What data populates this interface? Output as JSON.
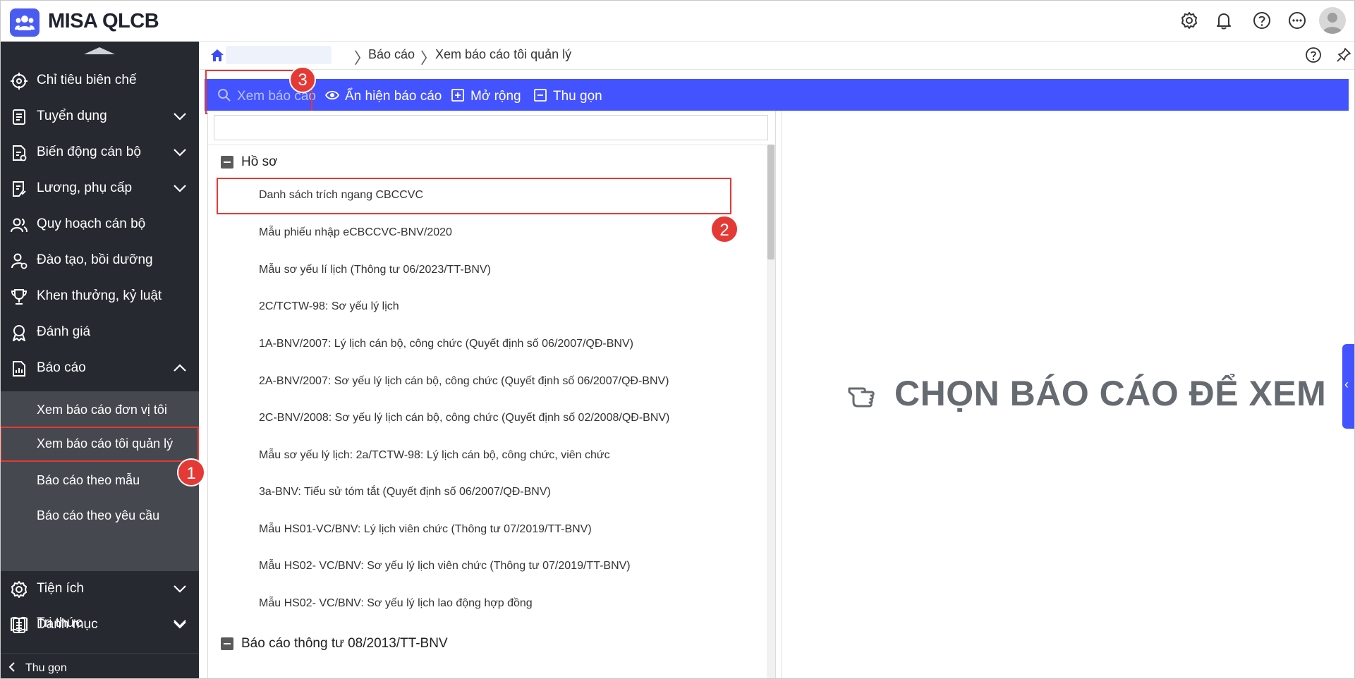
{
  "app": {
    "title": "MISA QLCB"
  },
  "header_icons": [
    "gear-icon",
    "bell-icon",
    "help-icon",
    "more-icon",
    "avatar-icon"
  ],
  "sidebar": {
    "items": [
      {
        "label": "Chỉ tiêu biên chế",
        "icon": "target-icon",
        "chevron": ""
      },
      {
        "label": "Tuyển dụng",
        "icon": "document-icon",
        "chevron": "down"
      },
      {
        "label": "Biến động cán bộ",
        "icon": "file-change-icon",
        "chevron": "down"
      },
      {
        "label": "Lương, phụ cấp",
        "icon": "payroll-icon",
        "chevron": "down"
      },
      {
        "label": "Quy hoạch cán bộ",
        "icon": "people-icon",
        "chevron": ""
      },
      {
        "label": "Đào tạo, bồi dưỡng",
        "icon": "person-training-icon",
        "chevron": ""
      },
      {
        "label": "Khen thưởng, kỷ luật",
        "icon": "trophy-icon",
        "chevron": ""
      },
      {
        "label": "Đánh giá",
        "icon": "award-icon",
        "chevron": ""
      },
      {
        "label": "Báo cáo",
        "icon": "report-icon",
        "chevron": "up"
      }
    ],
    "sub_items": [
      {
        "label": "Xem báo cáo đơn vị tôi"
      },
      {
        "label": "Xem báo cáo tôi quản lý"
      },
      {
        "label": "Báo cáo theo mẫu"
      },
      {
        "label": "Báo cáo theo yêu cầu"
      }
    ],
    "bottom_items": [
      {
        "label": "Tiện ích",
        "icon": "settings-icon",
        "chevron": "down"
      },
      {
        "label": "Danh mục",
        "icon": "list-icon",
        "chevron": "down"
      },
      {
        "label": "Tri thức",
        "icon": "book-icon",
        "chevron": "down"
      }
    ],
    "collapse_label": "Thu gọn"
  },
  "breadcrumb": {
    "level1": "Báo cáo",
    "level2": "Xem báo cáo tôi quản lý"
  },
  "toolbar": {
    "view_label": "Xem báo cáo",
    "toggle_label": "Ẩn hiện báo cáo",
    "expand_label": "Mở rộng",
    "collapse_label": "Thu gọn"
  },
  "report_list": {
    "search_placeholder": "",
    "group1": "Hồ sơ",
    "reports": [
      "Danh sách trích ngang CBCCVC",
      "Mẫu phiếu nhập eCBCCVC-BNV/2020",
      "Mẫu sơ yếu lí lịch (Thông tư 06/2023/TT-BNV)",
      "2C/TCTW-98: Sơ yếu lý lịch",
      "1A-BNV/2007: Lý lịch cán bộ, công chức (Quyết định số 06/2007/QĐ-BNV)",
      "2A-BNV/2007: Sơ yếu lý lịch cán bộ, công chức (Quyết định số 06/2007/QĐ-BNV)",
      "2C-BNV/2008: Sơ yếu lý lịch cán bộ, công chức (Quyết định số 02/2008/QĐ-BNV)",
      "Mẫu sơ yếu lý lịch: 2a/TCTW-98: Lý lịch cán bộ, công chức, viên chức",
      "3a-BNV: Tiểu sử tóm tắt (Quyết định số 06/2007/QĐ-BNV)",
      "Mẫu HS01-VC/BNV: Lý lịch viên chức (Thông tư 07/2019/TT-BNV)",
      "Mẫu HS02- VC/BNV: Sơ yếu lý lịch viên chức (Thông tư 07/2019/TT-BNV)",
      "Mẫu HS02- VC/BNV: Sơ yếu lý lịch lao động hợp đồng"
    ],
    "group2": "Báo cáo thông tư 08/2013/TT-BNV"
  },
  "view_panel": {
    "placeholder": "CHỌN BÁO CÁO ĐỂ XEM",
    "side_tab": "‹"
  },
  "annotations": {
    "step1": "1",
    "step2": "2",
    "step3": "3"
  },
  "colors": {
    "accent": "#4353ff",
    "sidebar": "#262a30",
    "highlight": "#e53935"
  }
}
